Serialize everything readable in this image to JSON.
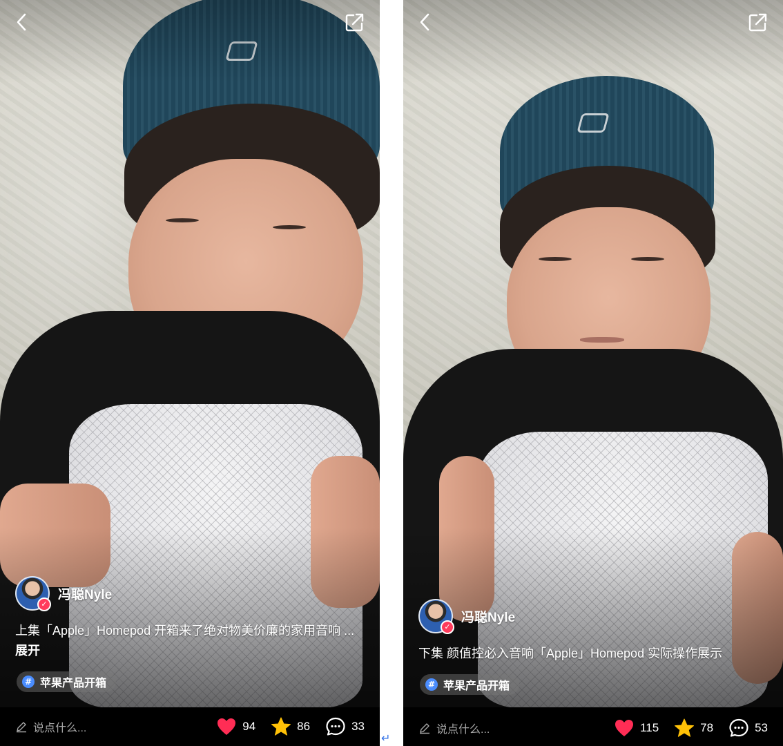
{
  "left": {
    "author": "冯聪Nyle",
    "caption": "上集「Apple」Homepod 开箱来了绝对物美价廉的家用音响 ...",
    "expand_label": "展开",
    "tag": "苹果产品开箱",
    "comment_placeholder": "说点什么...",
    "likes": "94",
    "favorites": "86",
    "comments": "33"
  },
  "right": {
    "author": "冯聪Nyle",
    "caption": "下集 颜值控必入音响「Apple」Homepod 实际操作展示",
    "tag": "苹果产品开箱",
    "comment_placeholder": "说点什么...",
    "likes": "115",
    "favorites": "78",
    "comments": "53"
  },
  "icons": {
    "back": "chevron-left-icon",
    "share": "share-icon",
    "pen": "pen-icon",
    "like": "heart-icon",
    "favorite": "star-icon",
    "comment": "comment-bubble-icon",
    "verified": "verified-badge-icon",
    "hashtag": "hashtag-icon"
  },
  "colors": {
    "like": "#ff2d55",
    "favorite": "#ffc107",
    "verified": "#ff3b5c",
    "hashtag": "#4a8dff"
  },
  "symbols": {
    "hashtag": "#",
    "check": "✓",
    "return": "↵"
  }
}
